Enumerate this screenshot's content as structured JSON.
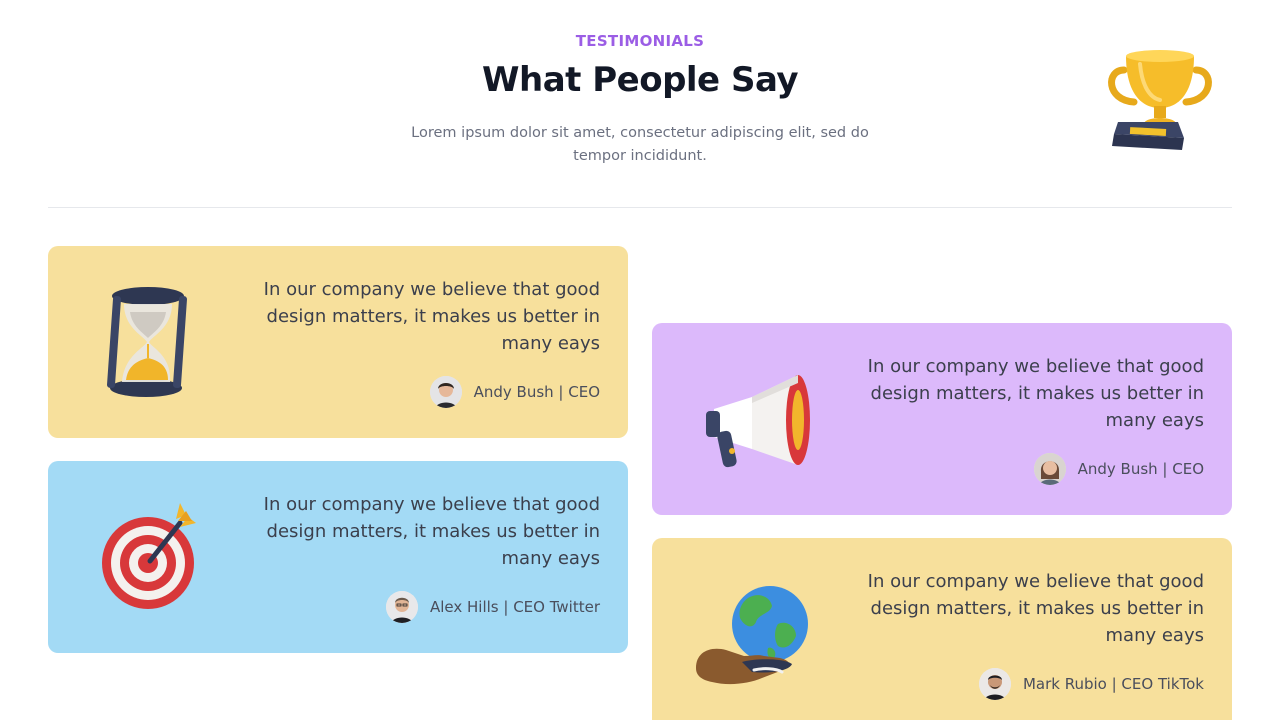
{
  "header": {
    "eyebrow": "TESTIMONIALS",
    "title": "What People Say",
    "subtitle": "Lorem ipsum dolor sit amet, consectetur adipiscing elit, sed do tempor incididunt.",
    "accent_color": "#9b5de5",
    "decoration_icon": "trophy-icon"
  },
  "testimonials": [
    {
      "quote": "In our company we believe that good design matters, it makes us better in many eays",
      "author": "Andy Bush | CEO",
      "illustration": "hourglass-icon",
      "background": "#f7e09c"
    },
    {
      "quote": "In our company we believe that good design matters, it makes us better in many eays",
      "author": "Alex Hills | CEO Twitter",
      "illustration": "target-icon",
      "background": "#a3daf5"
    },
    {
      "quote": "In our company we believe that good design matters, it makes us better in many eays",
      "author": "Andy Bush | CEO",
      "illustration": "megaphone-icon",
      "background": "#dcb9fb"
    },
    {
      "quote": "In our company we believe that good design matters, it makes us better in many eays",
      "author": "Mark Rubio | CEO TikTok",
      "illustration": "globe-in-hand-icon",
      "background": "#f7e09c"
    }
  ]
}
